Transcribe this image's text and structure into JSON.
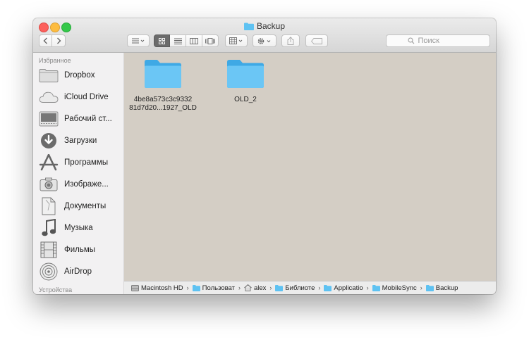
{
  "window": {
    "title": "Backup"
  },
  "toolbar": {
    "back_icon": "chevron-left-icon",
    "forward_icon": "chevron-right-icon",
    "search_placeholder": "Поиск"
  },
  "sidebar": {
    "favorites_heading": "Избранное",
    "devices_heading": "Устройства",
    "items": [
      {
        "label": "Dropbox",
        "icon": "folder-icon"
      },
      {
        "label": "iCloud Drive",
        "icon": "cloud-icon"
      },
      {
        "label": "Рабочий ст...",
        "icon": "desktop-icon"
      },
      {
        "label": "Загрузки",
        "icon": "downloads-icon"
      },
      {
        "label": "Программы",
        "icon": "applications-icon"
      },
      {
        "label": "Изображе...",
        "icon": "camera-icon"
      },
      {
        "label": "Документы",
        "icon": "document-icon"
      },
      {
        "label": "Музыка",
        "icon": "music-note-icon"
      },
      {
        "label": "Фильмы",
        "icon": "film-icon"
      },
      {
        "label": "AirDrop",
        "icon": "airdrop-icon"
      }
    ]
  },
  "files": [
    {
      "line1": "4be8a573c3c9332",
      "line2": "81d7d20...1927_OLD"
    },
    {
      "line1": "OLD_2",
      "line2": ""
    }
  ],
  "pathbar": {
    "items": [
      {
        "label": "Macintosh HD",
        "icon": "hard-drive-icon"
      },
      {
        "label": "Пользоват",
        "icon": "folder-icon"
      },
      {
        "label": "alex",
        "icon": "home-icon"
      },
      {
        "label": "Библиоте",
        "icon": "folder-icon"
      },
      {
        "label": "Applicatio",
        "icon": "folder-icon"
      },
      {
        "label": "MobileSync",
        "icon": "folder-icon"
      },
      {
        "label": "Backup",
        "icon": "folder-icon"
      }
    ]
  },
  "colors": {
    "content_bg": "#d4cec5",
    "folder_blue": "#5ec2f2",
    "sidebar_bg": "#f2f1f2",
    "close": "#fc605c",
    "minimize": "#fdbc40",
    "maximize": "#34c84a"
  }
}
